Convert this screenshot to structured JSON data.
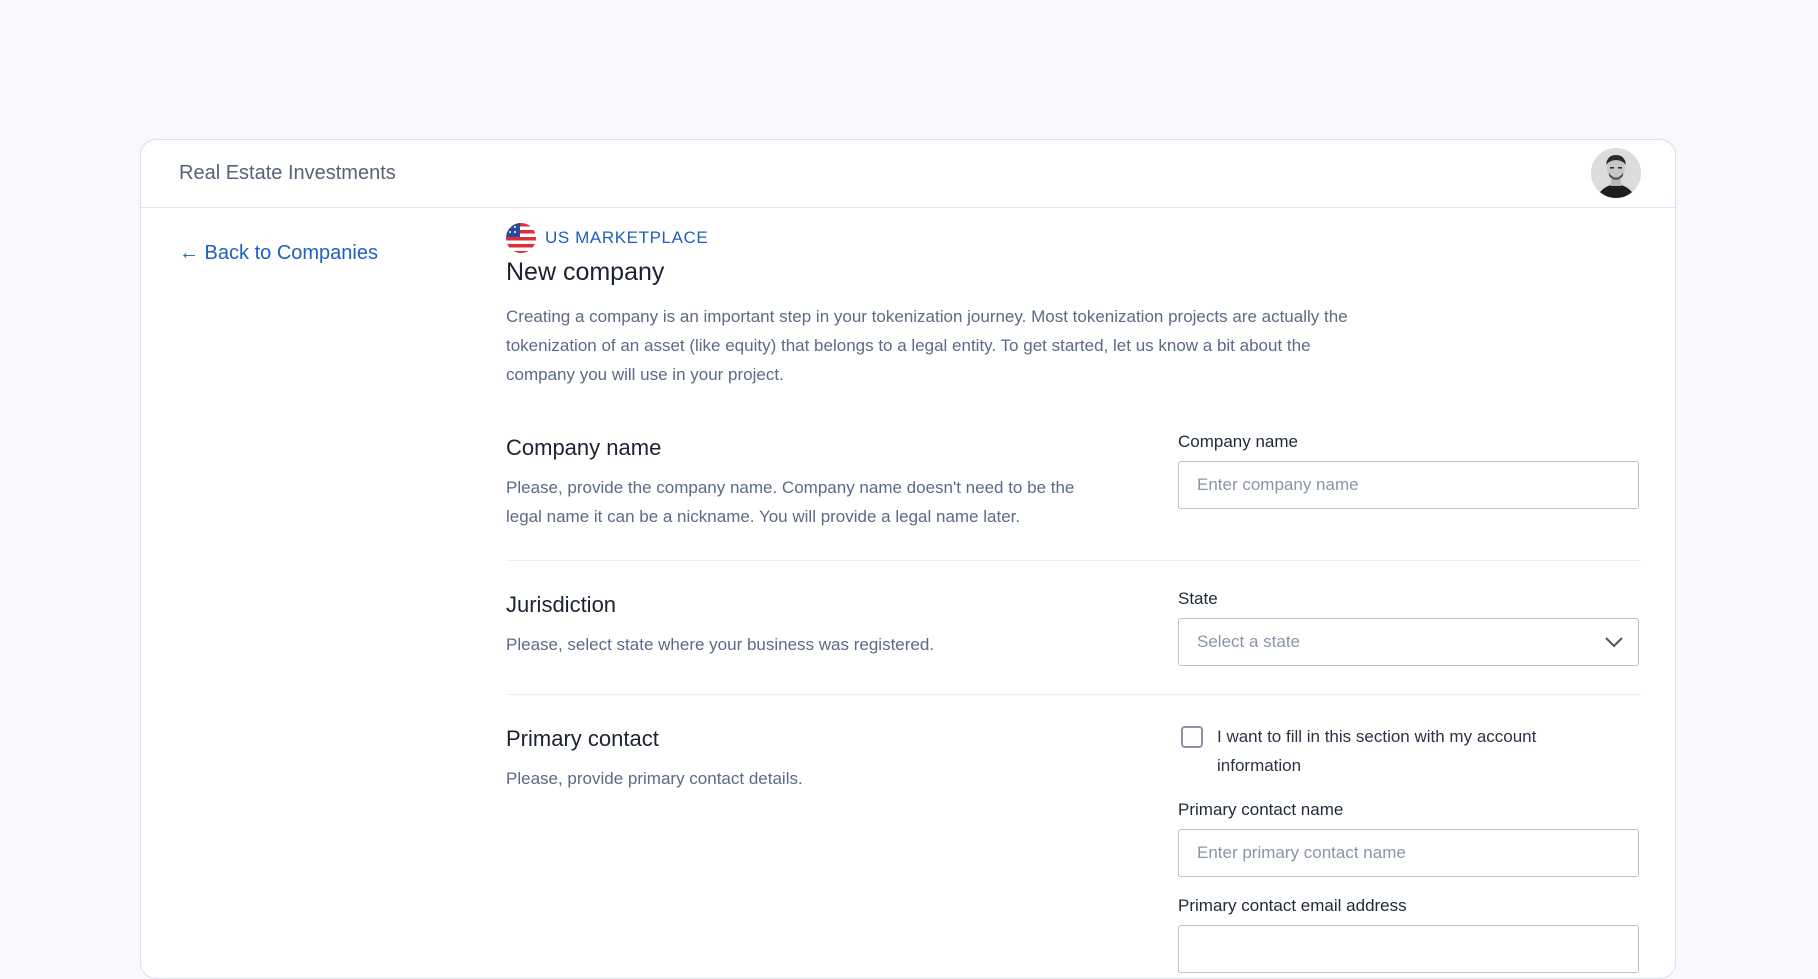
{
  "header": {
    "app_title": "Real Estate Investments",
    "avatar_icon": "user-avatar"
  },
  "nav": {
    "back_link": "← Back to Companies"
  },
  "marketplace": {
    "label": "US MARKETPLACE",
    "flag_icon": "us-flag-icon",
    "accent_color": "#1f5fbf"
  },
  "page": {
    "title": "New company",
    "intro": "Creating a company is an important step in your tokenization journey. Most tokenization projects are actually the tokenization of an asset (like equity) that belongs to a legal entity. To get started, let us know a bit about the company you will use in your project."
  },
  "sections": {
    "company_name": {
      "title": "Company name",
      "description": "Please, provide the company name. Company name doesn't need to be the legal name it can be a nickname. You will provide a legal name later.",
      "field_label": "Company name",
      "placeholder": "Enter company name",
      "value": ""
    },
    "jurisdiction": {
      "title": "Jurisdiction",
      "description": "Please, select state where your business was registered.",
      "field_label": "State",
      "selected": "Select a state"
    },
    "primary_contact": {
      "title": "Primary contact",
      "description": "Please, provide primary contact details.",
      "checkbox_label": "I want to fill in this section with my account information",
      "checkbox_checked": false,
      "name_label": "Primary contact name",
      "name_placeholder": "Enter primary contact name",
      "email_label": "Primary contact email address"
    }
  }
}
